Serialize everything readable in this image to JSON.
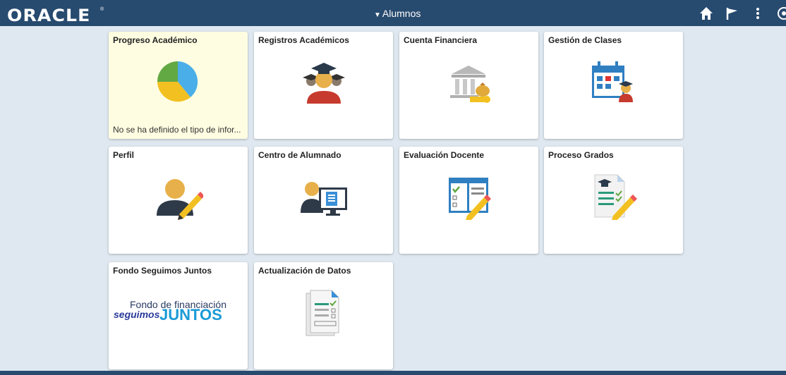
{
  "brand": {
    "name": "ORACLE"
  },
  "header": {
    "title": "Alumnos",
    "icons": [
      "home-icon",
      "flag-icon",
      "more-icon",
      "nav-icon"
    ]
  },
  "tiles": [
    {
      "title": "Progreso Académico",
      "footer": "No se ha definido el tipo de infor...",
      "icon": "pie-chart-icon",
      "selected": true
    },
    {
      "title": "Registros Académicos",
      "icon": "graduates-icon"
    },
    {
      "title": "Cuenta Financiera",
      "icon": "bank-icon"
    },
    {
      "title": "Gestión de Clases",
      "icon": "calendar-icon"
    },
    {
      "title": "Perfil",
      "icon": "profile-icon"
    },
    {
      "title": "Centro de Alumnado",
      "icon": "student-center-icon"
    },
    {
      "title": "Evaluación Docente",
      "icon": "evaluation-icon"
    },
    {
      "title": "Proceso Grados",
      "icon": "degree-process-icon"
    },
    {
      "title": "Fondo Seguimos Juntos",
      "icon": "fondo-logo",
      "logo": {
        "line1": "Fondo de financiación",
        "line2a": "seguimos",
        "line2b": "JUNTOS"
      }
    },
    {
      "title": "Actualización de Datos",
      "icon": "data-update-icon"
    }
  ],
  "colors": {
    "topbar": "#274a6f",
    "background": "#dfe8f0",
    "selected_tile": "#fffde1"
  }
}
